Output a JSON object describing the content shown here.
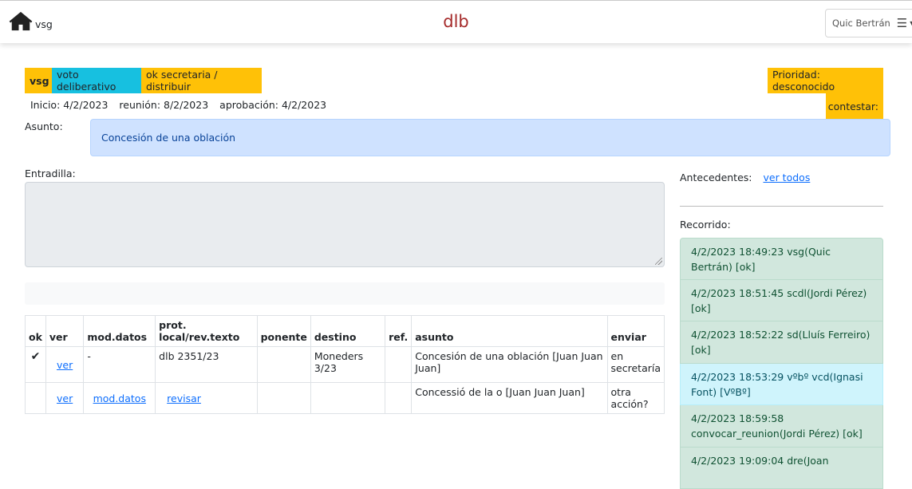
{
  "header": {
    "user_abbr": "vsg",
    "app_title": "dlb",
    "user_name": "Quic Bertrán"
  },
  "badges": {
    "vsg": "vsg",
    "voto": "voto deliberativo",
    "ok": "ok secretaria / distribuir",
    "prioridad": "Prioridad: desconocido",
    "contestar": "contestar:"
  },
  "dates": {
    "inicio": "Inicio: 4/2/2023",
    "reunion": "reunión: 8/2/2023",
    "aprobacion": "aprobación: 4/2/2023"
  },
  "asunto": {
    "label": "Asunto:",
    "value": "Concesión de una oblación"
  },
  "entradilla": {
    "label": "Entradilla:"
  },
  "table": {
    "headers": [
      "ok",
      "ver",
      "mod.datos",
      "prot. local/rev.texto",
      "ponente",
      "destino",
      "ref.",
      "asunto",
      "enviar"
    ],
    "rows": [
      {
        "ok": "✔",
        "ver": "ver",
        "mod": "-",
        "prot": "dlb 2351/23",
        "ponente": "",
        "destino": "Moneders 3/23",
        "ref": "",
        "asunto": "Concesión de una oblación [Juan Juan Juan]",
        "enviar": "en secretaría"
      },
      {
        "ok": "",
        "ver": "ver",
        "mod": "mod.datos",
        "prot": "revisar",
        "ponente": "",
        "destino": "",
        "ref": "",
        "asunto": "Concessió de la o [Juan Juan Juan]",
        "enviar": "otra acción?"
      }
    ]
  },
  "antecedentes": {
    "label": "Antecedentes:",
    "link": "ver todos"
  },
  "recorrido": {
    "label": "Recorrido:",
    "items": [
      "4/2/2023 18:49:23 vsg(Quic Bertrán) [ok]",
      "4/2/2023 18:51:45 scdl(Jordi Pérez) [ok]",
      "4/2/2023 18:52:22 sd(Lluís Ferreiro) [ok]",
      "4/2/2023 18:53:29 vºbº vcd(Ignasi Font) [VºBº]",
      "4/2/2023 18:59:58 convocar_reunion(Jordi Pérez) [ok]",
      "4/2/2023 19:09:04 dre(Joan"
    ]
  },
  "colors": {
    "accent_yellow": "#ffc107",
    "accent_cyan": "#17c0e0",
    "title_red": "#a52a2a"
  }
}
